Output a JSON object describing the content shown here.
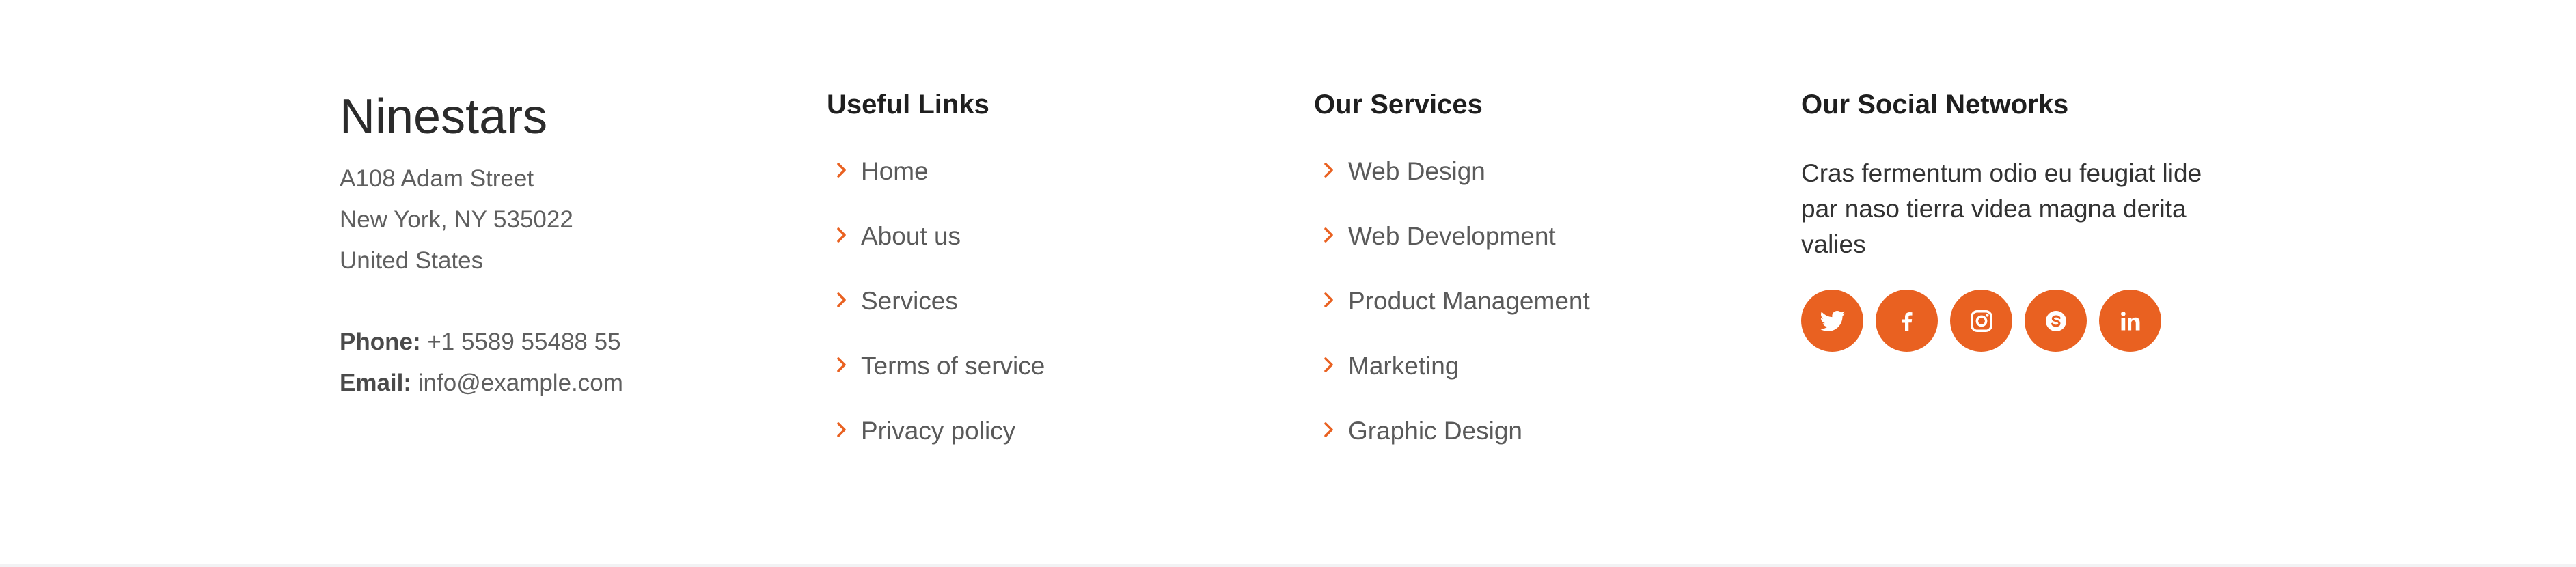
{
  "contact": {
    "brand": "Ninestars",
    "address": [
      "A108 Adam Street",
      "New York, NY 535022",
      "United States"
    ],
    "phone_label": "Phone:",
    "phone": "+1 5589 55488 55",
    "email_label": "Email:",
    "email": "info@example.com"
  },
  "useful_links": {
    "heading": "Useful Links",
    "items": [
      "Home",
      "About us",
      "Services",
      "Terms of service",
      "Privacy policy"
    ]
  },
  "services": {
    "heading": "Our Services",
    "items": [
      "Web Design",
      "Web Development",
      "Product Management",
      "Marketing",
      "Graphic Design"
    ]
  },
  "social": {
    "heading": "Our Social Networks",
    "description": "Cras fermentum odio eu feugiat lide par naso tierra videa magna derita valies",
    "icons": [
      "twitter-icon",
      "facebook-icon",
      "instagram-icon",
      "skype-icon",
      "linkedin-icon"
    ]
  },
  "colors": {
    "accent": "#e96121",
    "heading": "#1f1f1f",
    "body_text": "#5a5a5a"
  }
}
